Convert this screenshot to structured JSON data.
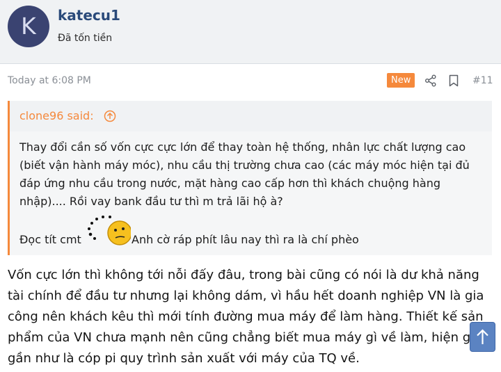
{
  "user": {
    "avatar_letter": "K",
    "name": "katecu1",
    "title": "Đã tốn tiền"
  },
  "post": {
    "time": "Today at 6:08 PM",
    "badge": "New",
    "number": "#11",
    "icons": [
      "share-icon",
      "bookmark-icon"
    ]
  },
  "quote": {
    "author": "clone96 said:",
    "text": "Thay đổi cần số vốn cực cực lớn để thay toàn hệ thống, nhân lực chất lượng cao (biết vận hành máy móc), nhu cầu thị trường chưa cao (các máy móc hiện tại đủ đáp ứng nhu cầu trong nước, mặt hàng cao cấp hơn thì khách chuộng hàng nhập).... Rồi vay bank đầu tư thì m trả lãi hộ à?",
    "line2_before": "Đọc tít cmt",
    "line2_after": "Anh cờ ráp phít lâu nay thì ra là chí phèo"
  },
  "body": {
    "text": "Vốn cực lớn thì không tới nỗi đấy đâu, trong bài cũng có nói là dư khả năng tài chính để đầu tư nhưng lại không dám, vì hầu hết doanh nghiệp VN là gia công nên khách kêu thì mới tính đường mua máy để làm hàng. Thiết kế sản phẩm của VN chưa mạnh nên cũng chẳng biết mua máy gì về làm, hiện giờ gần như là cóp pi quy trình sản xuất với máy của TQ về."
  },
  "colors": {
    "accent": "#f5893c",
    "username": "#2a4a7a",
    "avatar_bg": "#3a4371",
    "scroll_button": "#5b83c2"
  }
}
